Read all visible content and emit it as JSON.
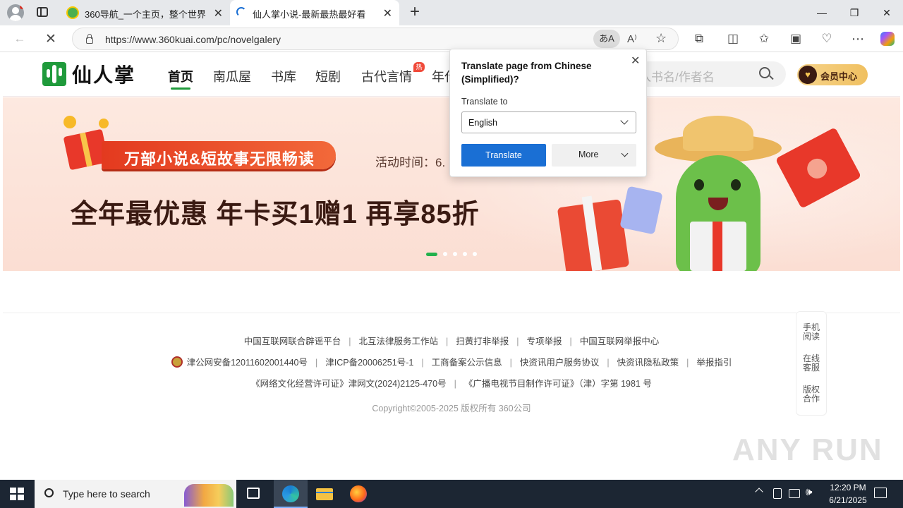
{
  "browser": {
    "tabs": [
      {
        "title": "360导航_一个主页，整个世界",
        "active": false
      },
      {
        "title": "仙人掌小说-最新最热最好看",
        "active": true
      }
    ],
    "url": "https://www.360kuai.com/pc/novelgalery"
  },
  "site": {
    "logo_text": "仙人掌",
    "nav": [
      "首页",
      "南瓜屋",
      "书库",
      "短剧",
      "古代言情",
      "年代"
    ],
    "hot_badge": "热",
    "search_placeholder": "入书名/作者名",
    "member_label": "会员中心"
  },
  "banner": {
    "tag_text": "万部小说&短故事无限畅读",
    "activity_text": "活动时间：6.",
    "headline": "全年最优惠 年卡买1赠1 再享85折",
    "dots": 5,
    "active_dot": 0
  },
  "footer": {
    "row1": [
      "中国互联网联合辟谣平台",
      "北互法律服务工作站",
      "扫黄打非举报",
      "专项举报",
      "中国互联网举报中心"
    ],
    "row2": [
      "津公网安备12011602001440号",
      "津ICP备20006251号-1",
      "工商备案公示信息",
      "快资讯用户服务协议",
      "快资讯隐私政策",
      "举报指引"
    ],
    "row3": [
      "《网络文化经营许可证》津网文(2024)2125-470号",
      "《广播电视节目制作许可证》（津）字第 1981 号"
    ],
    "copyright": "Copyright©2005-2025 版权所有 360公司"
  },
  "side_panel": [
    "手机\n阅读",
    "在线\n客服",
    "版权\n合作"
  ],
  "translate_popup": {
    "title": "Translate page from Chinese (Simplified)?",
    "to_label": "Translate to",
    "language": "English",
    "translate_button": "Translate",
    "more_button": "More"
  },
  "taskbar": {
    "search_placeholder": "Type here to search",
    "time": "12:20 PM",
    "date": "6/21/2025"
  },
  "watermark": "ANY RUN",
  "colors": {
    "accent_blue": "#1a6fd4",
    "site_green": "#1f9a3b",
    "banner_bg": "#fbe4da",
    "headline": "#3a1a12"
  }
}
